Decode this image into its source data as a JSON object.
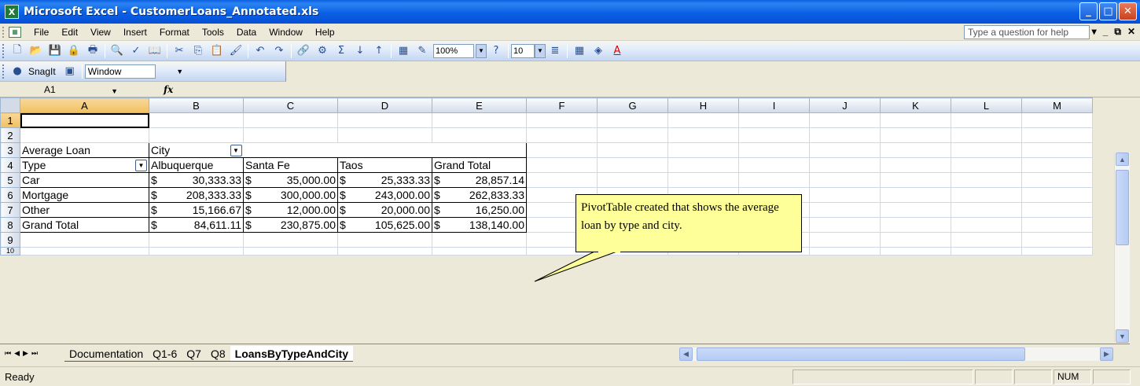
{
  "window": {
    "title": "Microsoft Excel - CustomerLoans_Annotated.xls",
    "minimize": "_",
    "maximize": "□",
    "close": "✕"
  },
  "menu": {
    "items": [
      "File",
      "Edit",
      "View",
      "Insert",
      "Format",
      "Tools",
      "Data",
      "Window",
      "Help"
    ],
    "help_placeholder": "Type a question for help",
    "right_controls": [
      "▾",
      "_",
      "⧉",
      "✕"
    ]
  },
  "toolbar": {
    "zoom": "100%",
    "font_size": "10",
    "icons": [
      "new-icon",
      "open-icon",
      "save-icon",
      "permission-icon",
      "print-icon",
      "print-preview-icon",
      "spelling-icon",
      "research-icon",
      "cut-icon",
      "copy-icon",
      "paste-icon",
      "format-painter-icon",
      "undo-icon",
      "redo-icon",
      "hyperlink-icon",
      "insert-chart-icon",
      "autosum-icon",
      "sort-asc-icon",
      "sort-desc-icon",
      "chart-wizard-icon",
      "drawing-icon",
      "help-icon"
    ],
    "symbols": {
      "new": "🗋",
      "open": "📂",
      "save": "💾",
      "permission": "🔒",
      "print": "🖶",
      "preview": "🔍",
      "spelling": "✓",
      "research": "📖",
      "cut": "✂",
      "copy": "⎘",
      "paste": "📋",
      "painter": "🖌",
      "undo": "↶",
      "redo": "↷",
      "hyperlink": "🔗",
      "map": "⚙",
      "sum": "Σ",
      "sortasc": "↓",
      "sortdesc": "↑",
      "chart": "▦",
      "drawing": "✎",
      "help": "?",
      "align": "≣",
      "borders": "▦",
      "fill": "◈",
      "fontcolor": "A"
    }
  },
  "snagit": {
    "label": "SnagIt",
    "window_value": "Window"
  },
  "formula_bar": {
    "name_box": "A1",
    "fx": "fx",
    "content": ""
  },
  "sheet": {
    "columns": [
      "A",
      "B",
      "C",
      "D",
      "E",
      "F",
      "G",
      "H",
      "I",
      "J",
      "K",
      "L",
      "M"
    ],
    "rows": [
      "1",
      "2",
      "3",
      "4",
      "5",
      "6",
      "7",
      "8",
      "9",
      "10"
    ],
    "pivot": {
      "data_field": "Average Loan",
      "column_field": "City",
      "row_field": "Type",
      "column_items": [
        "Albuquerque",
        "Santa Fe",
        "Taos",
        "Grand Total"
      ],
      "rows": [
        {
          "label": "Car",
          "values": [
            "30,333.33",
            "35,000.00",
            "25,333.33",
            "28,857.14"
          ]
        },
        {
          "label": "Mortgage",
          "values": [
            "208,333.33",
            "300,000.00",
            "243,000.00",
            "262,833.33"
          ]
        },
        {
          "label": "Other",
          "values": [
            "15,166.67",
            "12,000.00",
            "20,000.00",
            "16,250.00"
          ]
        },
        {
          "label": "Grand Total",
          "values": [
            "84,611.11",
            "230,875.00",
            "105,625.00",
            "138,140.00"
          ]
        }
      ],
      "currency": "$"
    },
    "callout": "PivotTable created that shows the average loan by type and city."
  },
  "tabs": {
    "nav": [
      "⏮",
      "◀",
      "▶",
      "⏭"
    ],
    "items": [
      "Documentation",
      "Q1-6",
      "Q7",
      "Q8",
      "LoansByTypeAndCity"
    ],
    "active": "LoansByTypeAndCity"
  },
  "status": {
    "ready": "Ready",
    "num": "NUM"
  }
}
